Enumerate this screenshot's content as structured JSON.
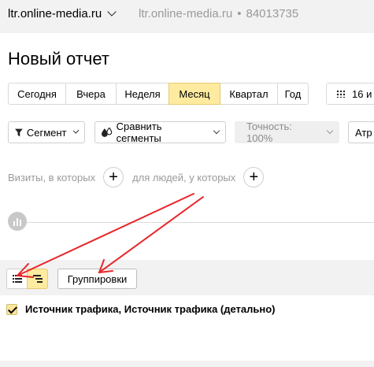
{
  "header": {
    "site": "ltr.online-media.ru",
    "site_secondary": "ltr.online-media.ru",
    "separator": "•",
    "counter_id": "84013735"
  },
  "page_title": "Новый отчет",
  "periods": [
    {
      "label": "Сегодня",
      "active": false
    },
    {
      "label": "Вчера",
      "active": false
    },
    {
      "label": "Неделя",
      "active": false
    },
    {
      "label": "Месяц",
      "active": true
    },
    {
      "label": "Квартал",
      "active": false
    },
    {
      "label": "Год",
      "active": false
    }
  ],
  "date_range": {
    "label": "16 и"
  },
  "filters": {
    "segment": "Сегмент",
    "compare": "Сравнить сегменты",
    "accuracy": "Точность: 100%",
    "attribution": "Атр"
  },
  "segment_builder": {
    "visits_label": "Визиты, в которых",
    "people_label": "для людей, у которых",
    "plus": "+"
  },
  "table_toolbar": {
    "groupings_label": "Группировки"
  },
  "dimensions": {
    "checked": true,
    "label": "Источник трафика, Источник трафика (детально)"
  },
  "colors": {
    "accent_yellow": "#ffeba0",
    "arrow_red": "#e8262b",
    "panel_gray": "#f2f2f2"
  }
}
